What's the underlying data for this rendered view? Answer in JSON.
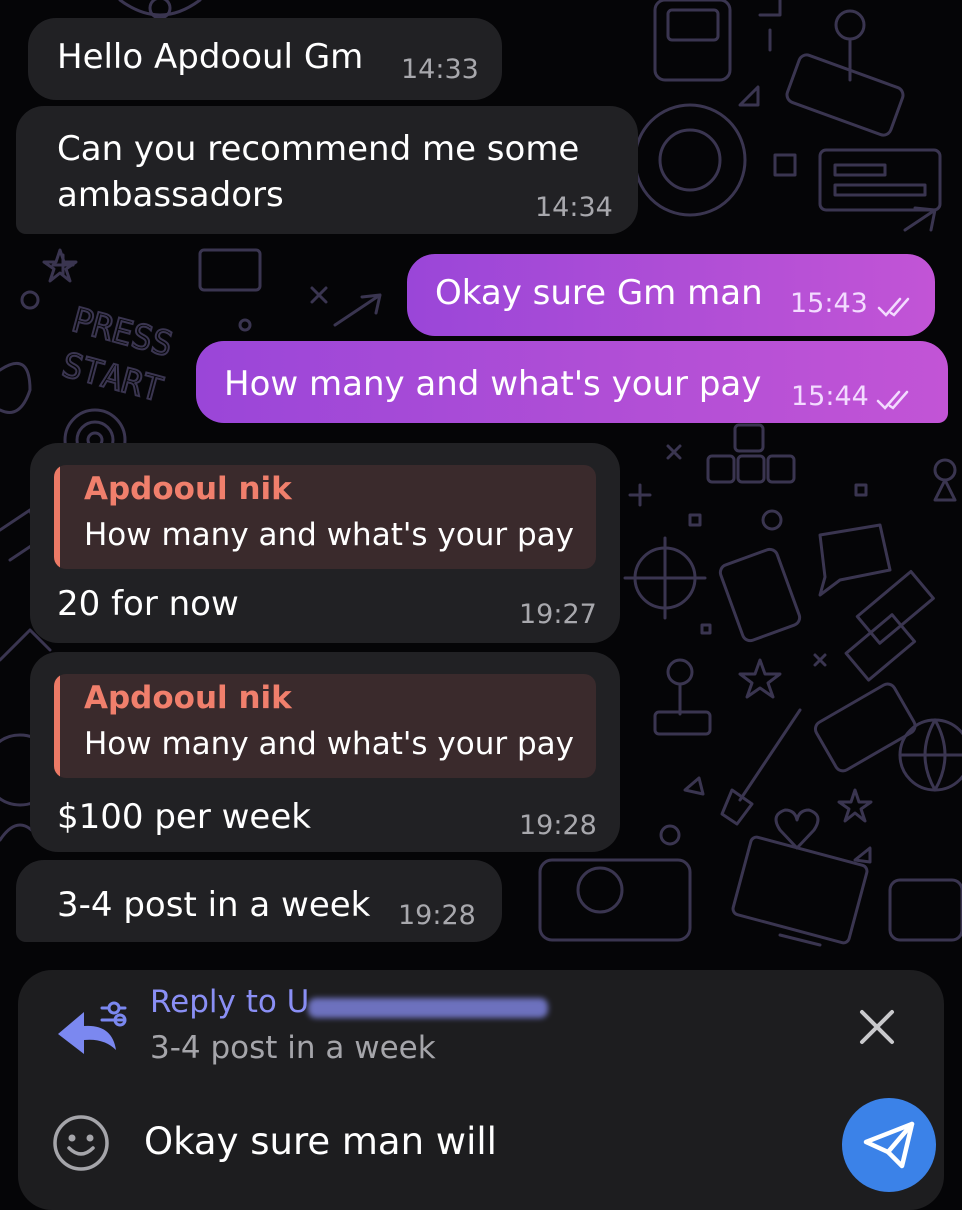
{
  "messages": [
    {
      "text": "Hello Apdooul Gm",
      "time": "14:33"
    },
    {
      "text_line1": "Can you recommend me some",
      "text_line2": "ambassadors",
      "time": "14:34"
    },
    {
      "text": "Okay sure Gm man",
      "time": "15:43",
      "status": "read"
    },
    {
      "text": "How many and what's your pay",
      "time": "15:44",
      "status": "read"
    },
    {
      "quote_name": "Apdooul nik",
      "quote_text": "How many and what's your pay",
      "text": "20 for now",
      "time": "19:27"
    },
    {
      "quote_name": "Apdooul nik",
      "quote_text": "How many and what's your pay",
      "text": "$100 per week",
      "time": "19:28"
    },
    {
      "text": "3-4 post in a week",
      "time": "19:28"
    }
  ],
  "composer": {
    "reply_label": "Reply to U",
    "reply_text": "3-4 post in a week",
    "input_value": "Okay sure man will"
  },
  "icons": [
    "reply-arrow-icon",
    "close-icon",
    "emoji-icon",
    "send-icon",
    "double-check-icon"
  ],
  "colors": {
    "outgoing_bubble": "#b24fd6",
    "incoming_bubble": "#212124",
    "quote_accent": "#ec7a66",
    "send_button": "#3b82e8",
    "reply_accent": "#8a8ff5"
  }
}
